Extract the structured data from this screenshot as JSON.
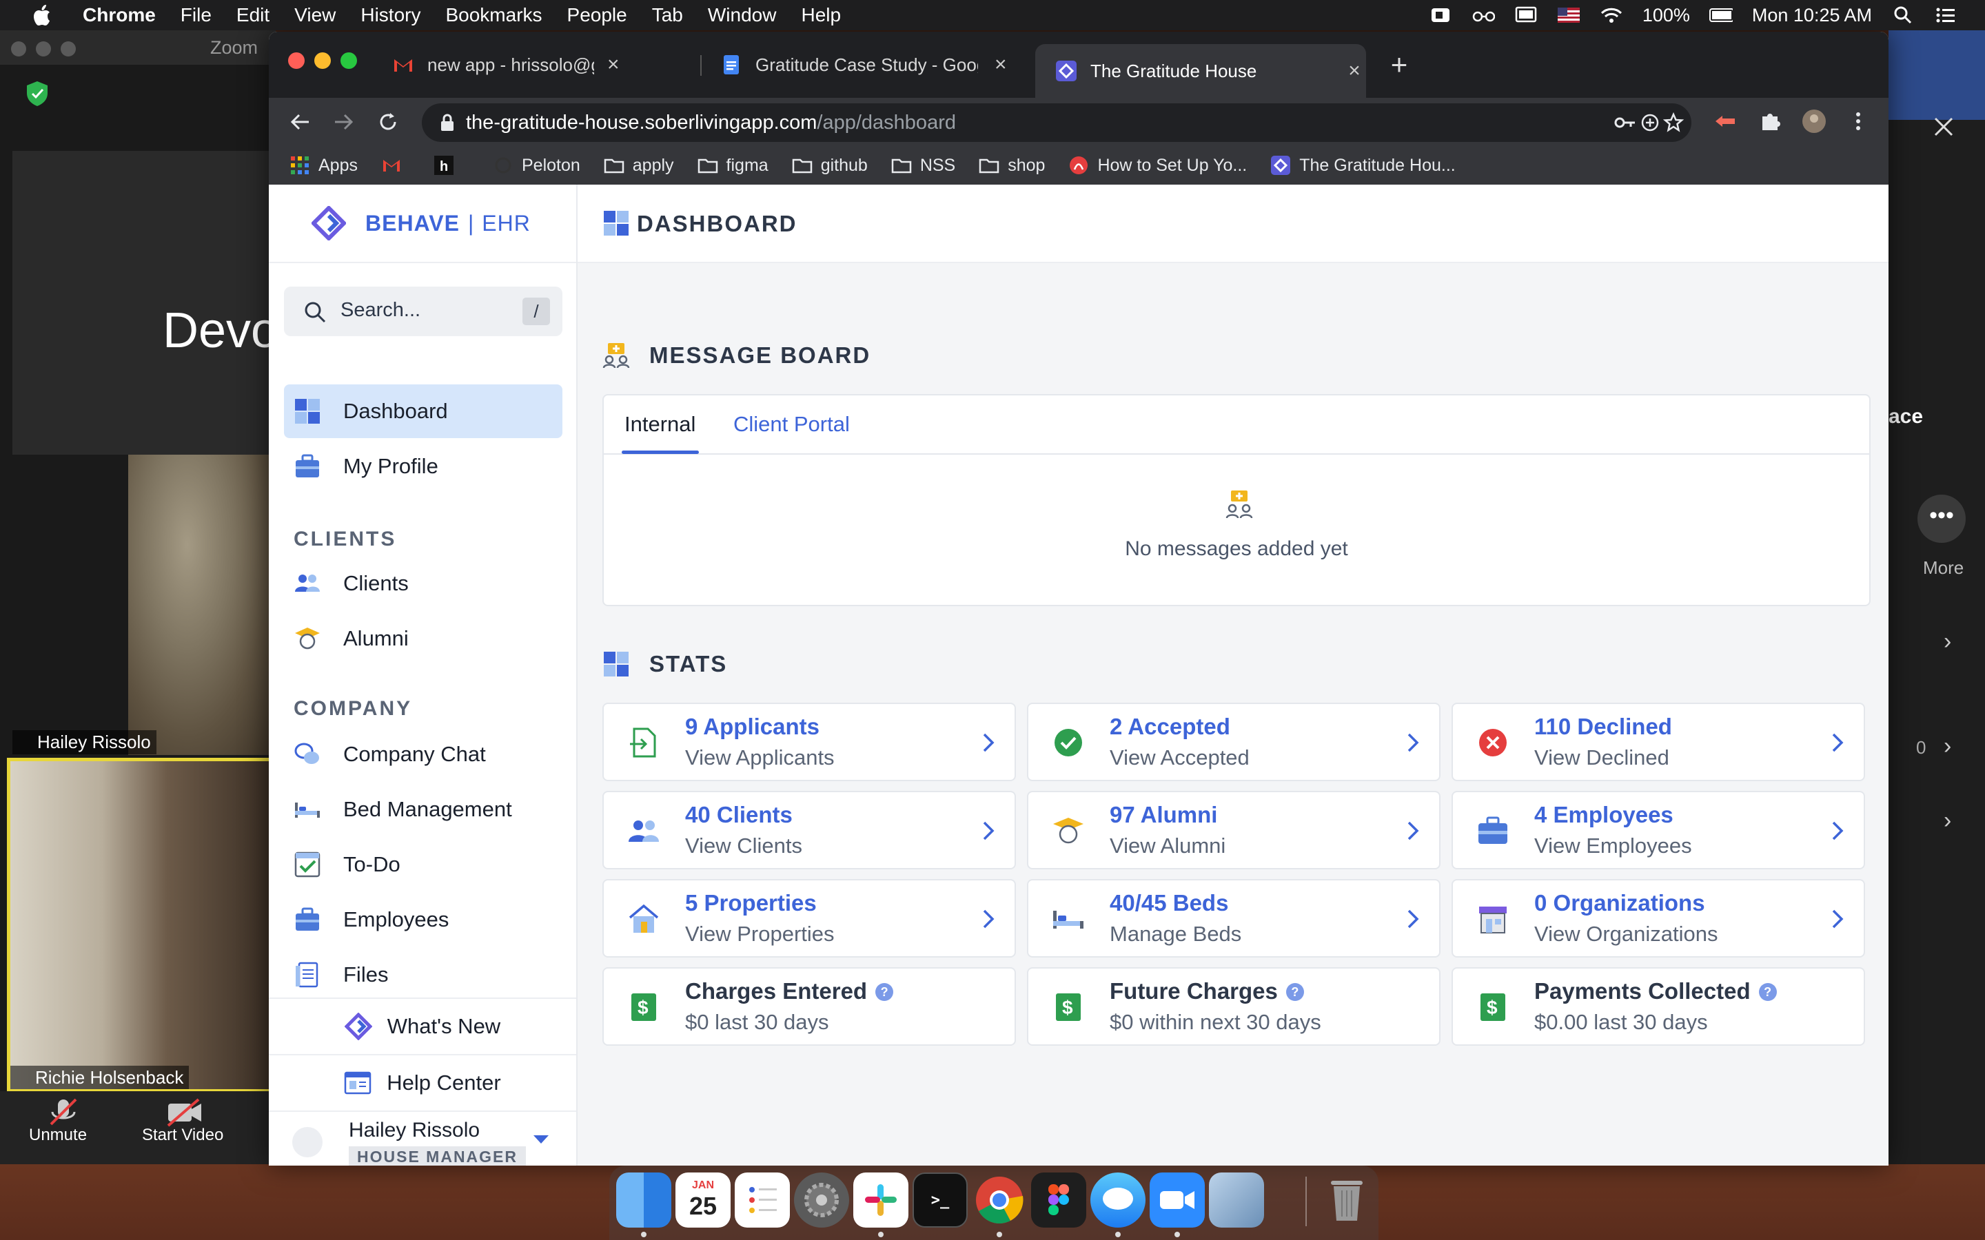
{
  "menubar": {
    "app_name": "Chrome",
    "menus": [
      "File",
      "Edit",
      "View",
      "History",
      "Bookmarks",
      "People",
      "Tab",
      "Window",
      "Help"
    ],
    "battery": "100%",
    "clock": "Mon 10:25 AM"
  },
  "zoom": {
    "title": "Zoom",
    "speaker_text": "Devo",
    "participants": [
      "Hailey Rissolo",
      "Richie Holsenback"
    ],
    "unmute_label": "Unmute",
    "start_video_label": "Start Video",
    "right_panel_fragment": "ace",
    "more_label": "More",
    "count_zero": "0"
  },
  "chrome": {
    "tabs": [
      {
        "title": "new app - hrissolo@gmail.com",
        "icon": "gmail-icon",
        "active": false
      },
      {
        "title": "Gratitude Case Study - Google",
        "icon": "google-docs-icon",
        "active": false
      },
      {
        "title": "The Gratitude House",
        "icon": "behave-icon",
        "active": true
      }
    ],
    "url_host": "the-gratitude-house.soberlivingapp.com",
    "url_path": "/app/dashboard",
    "bookmarks": [
      "Apps",
      "Peloton",
      "apply",
      "figma",
      "github",
      "NSS",
      "shop",
      "How to Set Up Yo...",
      "The Gratitude Hou..."
    ]
  },
  "app": {
    "brand_primary": "BEHAVE",
    "brand_separator": "|",
    "brand_secondary": "EHR",
    "search_placeholder": "Search...",
    "search_shortcut": "/",
    "nav": {
      "dashboard": "Dashboard",
      "my_profile": "My Profile",
      "clients_section": "CLIENTS",
      "clients": "Clients",
      "alumni": "Alumni",
      "company_section": "COMPANY",
      "company_chat": "Company Chat",
      "bed_management": "Bed Management",
      "todo": "To-Do",
      "employees": "Employees",
      "files": "Files",
      "whats_new": "What's New",
      "help_center": "Help Center"
    },
    "user": {
      "name": "Hailey Rissolo",
      "role": "HOUSE MANAGER"
    },
    "page_title": "DASHBOARD",
    "message_board": {
      "title": "MESSAGE BOARD",
      "tabs": [
        "Internal",
        "Client Portal"
      ],
      "empty_text": "No messages added yet"
    },
    "stats_title": "STATS",
    "stats": [
      {
        "title": "9 Applicants",
        "sub": "View Applicants",
        "icon": "file-import-icon"
      },
      {
        "title": "2 Accepted",
        "sub": "View Accepted",
        "icon": "check-circle-icon"
      },
      {
        "title": "110 Declined",
        "sub": "View Declined",
        "icon": "x-circle-icon"
      },
      {
        "title": "40 Clients",
        "sub": "View Clients",
        "icon": "users-icon"
      },
      {
        "title": "97 Alumni",
        "sub": "View Alumni",
        "icon": "graduate-icon"
      },
      {
        "title": "4 Employees",
        "sub": "View Employees",
        "icon": "briefcase-icon"
      },
      {
        "title": "5 Properties",
        "sub": "View Properties",
        "icon": "house-icon"
      },
      {
        "title": "40/45 Beds",
        "sub": "Manage Beds",
        "icon": "bed-icon"
      },
      {
        "title": "0 Organizations",
        "sub": "View Organizations",
        "icon": "store-icon"
      }
    ],
    "charges": [
      {
        "title": "Charges Entered",
        "sub": "$0 last 30 days"
      },
      {
        "title": "Future Charges",
        "sub": "$0 within next 30 days"
      },
      {
        "title": "Payments Collected",
        "sub": "$0.00 last 30 days"
      }
    ],
    "help_badge": "?"
  },
  "dock": {
    "calendar_month": "JAN",
    "calendar_day": "25"
  },
  "colors": {
    "accent": "#3d64d8",
    "active_nav_bg": "#d6e6fb",
    "success": "#2e9e4f",
    "danger": "#e53e3e",
    "money": "#2e9e4f"
  }
}
